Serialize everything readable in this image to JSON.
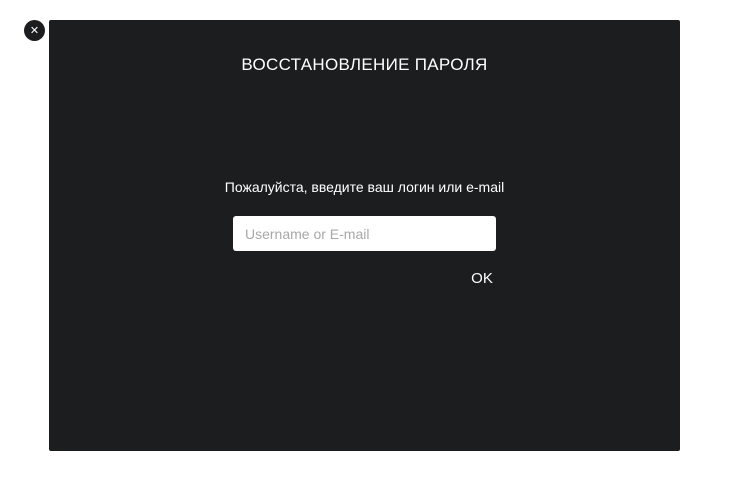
{
  "close": {
    "icon": "close-icon",
    "glyph": "✕"
  },
  "modal": {
    "title": "ВОССТАНОВЛЕНИЕ ПАРОЛЯ",
    "prompt": "Пожалуйста, введите ваш логин или e-mail",
    "input": {
      "placeholder": "Username or E-mail",
      "value": ""
    },
    "ok_label": "OK"
  },
  "colors": {
    "modal_background": "#1c1d1f",
    "text": "#ffffff",
    "input_background": "#ffffff",
    "placeholder": "#a8a8a8"
  }
}
